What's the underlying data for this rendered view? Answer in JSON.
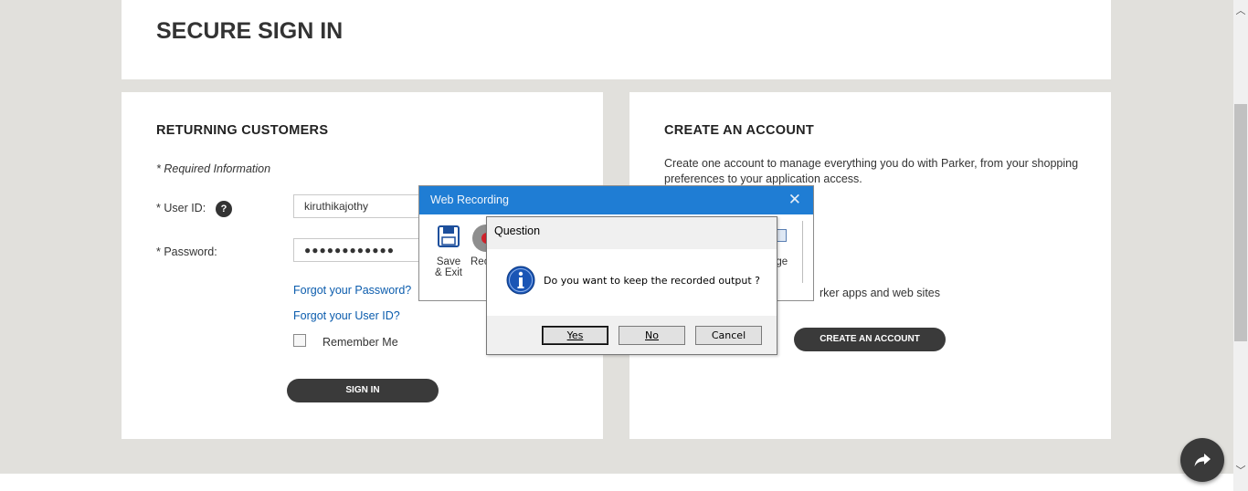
{
  "page": {
    "title": "SECURE SIGN IN"
  },
  "returning": {
    "heading": "RETURNING CUSTOMERS",
    "required_info": "* Required Information",
    "user_id_label": "* User ID:",
    "help_glyph": "?",
    "user_id_value": "kiruthikajothy",
    "password_label": "* Password:",
    "password_value": "●●●●●●●●●●●●",
    "forgot_password": "Forgot your Password?",
    "forgot_user_id": "Forgot your User ID?",
    "remember_me": "Remember Me",
    "sign_in_button": "SIGN IN"
  },
  "create_account": {
    "heading": "CREATE AN ACCOUNT",
    "description": "Create one account to manage everything you do with Parker, from your shopping preferences to your application access.",
    "partial_text": "rker apps and web sites",
    "button": "CREATE AN ACCOUNT"
  },
  "web_recording": {
    "title": "Web Recording",
    "close_glyph": "✕",
    "save_label_line1": "Save",
    "save_label_line2": "& Exit",
    "record_label_partial": "Rec",
    "image_label_partial": "age"
  },
  "question_dialog": {
    "title": "Question",
    "message": "Do you want to keep the recorded output ?",
    "yes_label": "Yes",
    "no_label": "No",
    "cancel_label": "Cancel"
  },
  "scrollbar": {
    "up_glyph": "︿",
    "down_glyph": "﹀"
  },
  "icons": {
    "share": "share-arrow-icon",
    "save": "floppy-disk-icon",
    "record": "record-icon",
    "info": "info-icon",
    "image": "image-icon"
  },
  "colors": {
    "accent_blue": "#1f7dd4",
    "link": "#0b5cad",
    "button_dark": "#3a3a3a",
    "page_bg": "#e1e0dc"
  }
}
